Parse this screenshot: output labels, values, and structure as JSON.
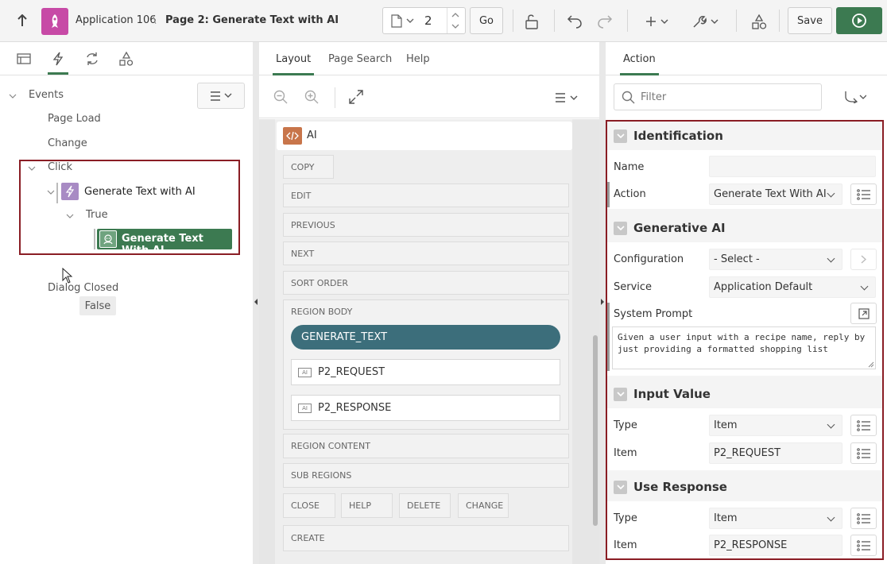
{
  "toolbar": {
    "app_name": "Application 106",
    "separator": "\\",
    "page_title": "Page 2: Generate Text with AI",
    "page_number": "2",
    "go_label": "Go",
    "save_label": "Save"
  },
  "left": {
    "tree": {
      "events": "Events",
      "page_load": "Page Load",
      "change": "Change",
      "click": "Click",
      "dynamic_action": "Generate Text with AI",
      "true_branch": "True",
      "action_node": "Generate Text With AI",
      "false_branch": "False",
      "dialog_closed": "Dialog Closed"
    }
  },
  "middle": {
    "tabs": [
      "Layout",
      "Page Search",
      "Help"
    ],
    "region_name": "AI",
    "slots": {
      "copy": "COPY",
      "edit": "EDIT",
      "previous": "PREVIOUS",
      "next": "NEXT",
      "sort_order": "SORT ORDER",
      "region_body": "REGION BODY",
      "region_content": "REGION CONTENT",
      "sub_regions": "SUB REGIONS",
      "close": "CLOSE",
      "help": "HELP",
      "delete": "DELETE",
      "change": "CHANGE",
      "create": "CREATE"
    },
    "button_name": "GENERATE_TEXT",
    "items": [
      "P2_REQUEST",
      "P2_RESPONSE"
    ],
    "item_tag": "AI"
  },
  "right": {
    "tab": "Action",
    "filter_placeholder": "Filter",
    "identification": {
      "title": "Identification",
      "name_label": "Name",
      "name_value": "",
      "action_label": "Action",
      "action_value": "Generate Text With AI"
    },
    "generative_ai": {
      "title": "Generative AI",
      "config_label": "Configuration",
      "config_value": "- Select -",
      "service_label": "Service",
      "service_value": "Application Default",
      "prompt_label": "System Prompt",
      "prompt_value": "Given a user input with a recipe name, reply by just providing a formatted shopping list"
    },
    "input_value": {
      "title": "Input Value",
      "type_label": "Type",
      "type_value": "Item",
      "item_label": "Item",
      "item_value": "P2_REQUEST"
    },
    "use_response": {
      "title": "Use Response",
      "type_label": "Type",
      "type_value": "Item",
      "item_label": "Item",
      "item_value": "P2_RESPONSE"
    }
  },
  "colors": {
    "accent_green": "#3c7a51",
    "button_teal": "#3c6e7b",
    "app_icon": "#c74aa6",
    "highlight_red": "#8a1d24"
  }
}
